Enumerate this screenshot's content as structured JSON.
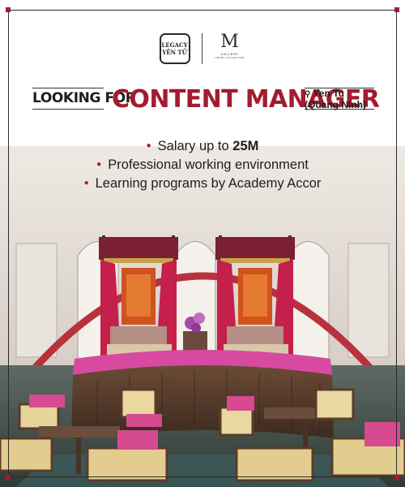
{
  "brand": {
    "legacy_logo_line1": "LEGACY",
    "legacy_logo_line2": "YÊN TỬ",
    "mgallery_mark": "M",
    "mgallery_line1": "GALLERY",
    "mgallery_line2": "HOTEL COLLECTION"
  },
  "headline": {
    "prefix": "LOOKING FOR",
    "role": "CONTENT MANAGER",
    "location_line1": "Yen Tu",
    "location_line2": "(Quang Ninh)"
  },
  "benefits": {
    "item1_text": "Salary up to ",
    "item1_highlight": "25M",
    "item2": "Professional working environment",
    "item3": "Learning programs by Academy Accor"
  },
  "colors": {
    "accent": "#a31b2f",
    "text": "#1e1e1e"
  },
  "icons": {
    "location": "map-pin-icon"
  }
}
